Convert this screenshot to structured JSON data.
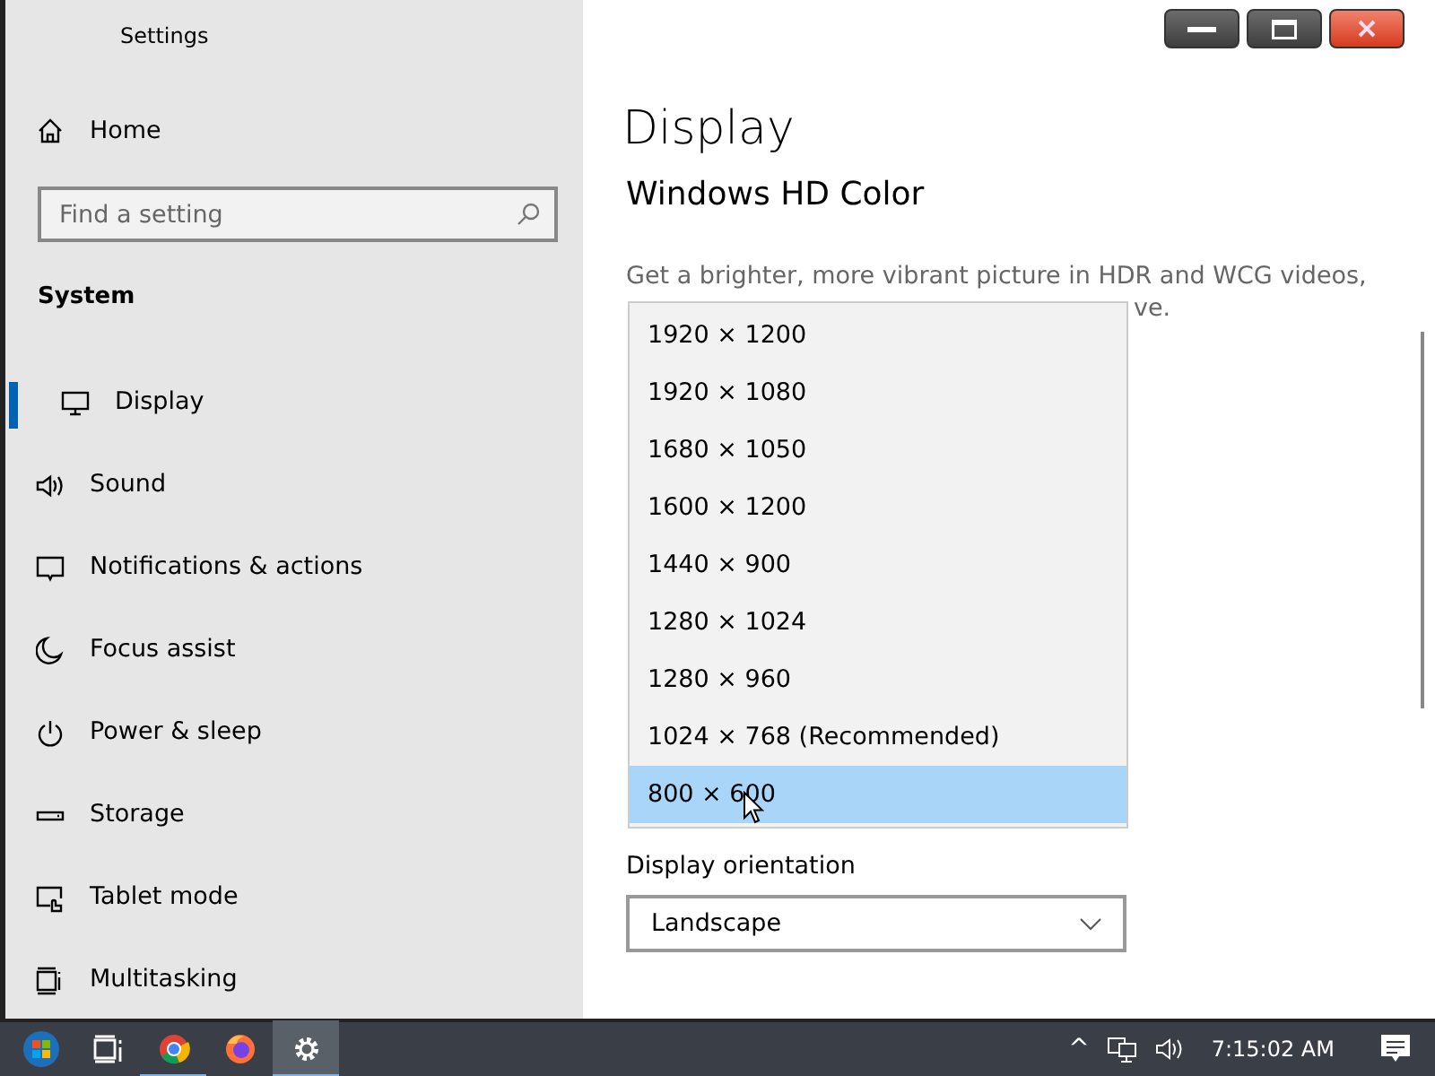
{
  "window": {
    "title": "Settings"
  },
  "sidebar": {
    "home": "Home",
    "search": {
      "placeholder": "Find a setting"
    },
    "section": "System",
    "items": [
      {
        "label": "Display",
        "selected": true
      },
      {
        "label": "Sound",
        "selected": false
      },
      {
        "label": "Notifications & actions",
        "selected": false
      },
      {
        "label": "Focus assist",
        "selected": false
      },
      {
        "label": "Power & sleep",
        "selected": false
      },
      {
        "label": "Storage",
        "selected": false
      },
      {
        "label": "Tablet mode",
        "selected": false
      },
      {
        "label": "Multitasking",
        "selected": false
      }
    ]
  },
  "content": {
    "title": "Display",
    "heading": "Windows HD Color",
    "description": "Get a brighter, more vibrant picture in HDR and WCG videos,",
    "description_fragment": "ve.",
    "orientation": {
      "label": "Display orientation",
      "value": "Landscape"
    }
  },
  "resolution_dropdown": {
    "options": [
      {
        "label": "1920 × 1200",
        "selected": false
      },
      {
        "label": "1920 × 1080",
        "selected": false
      },
      {
        "label": "1680 × 1050",
        "selected": false
      },
      {
        "label": "1600 × 1200",
        "selected": false
      },
      {
        "label": "1440 × 900",
        "selected": false
      },
      {
        "label": "1280 × 1024",
        "selected": false
      },
      {
        "label": "1280 × 960",
        "selected": false
      },
      {
        "label": "1024 × 768 (Recommended)",
        "selected": false
      },
      {
        "label": "800 × 600",
        "selected": true
      }
    ]
  },
  "taskbar": {
    "apps": [
      {
        "kind": "start",
        "running": false,
        "selected": false
      },
      {
        "kind": "taskview",
        "running": false,
        "selected": false
      },
      {
        "kind": "chrome",
        "running": true,
        "selected": false
      },
      {
        "kind": "firefox",
        "running": false,
        "selected": false
      },
      {
        "kind": "settings",
        "running": true,
        "selected": true
      }
    ],
    "tray": {
      "chevron": "^",
      "time": "7:15:02 AM"
    }
  }
}
